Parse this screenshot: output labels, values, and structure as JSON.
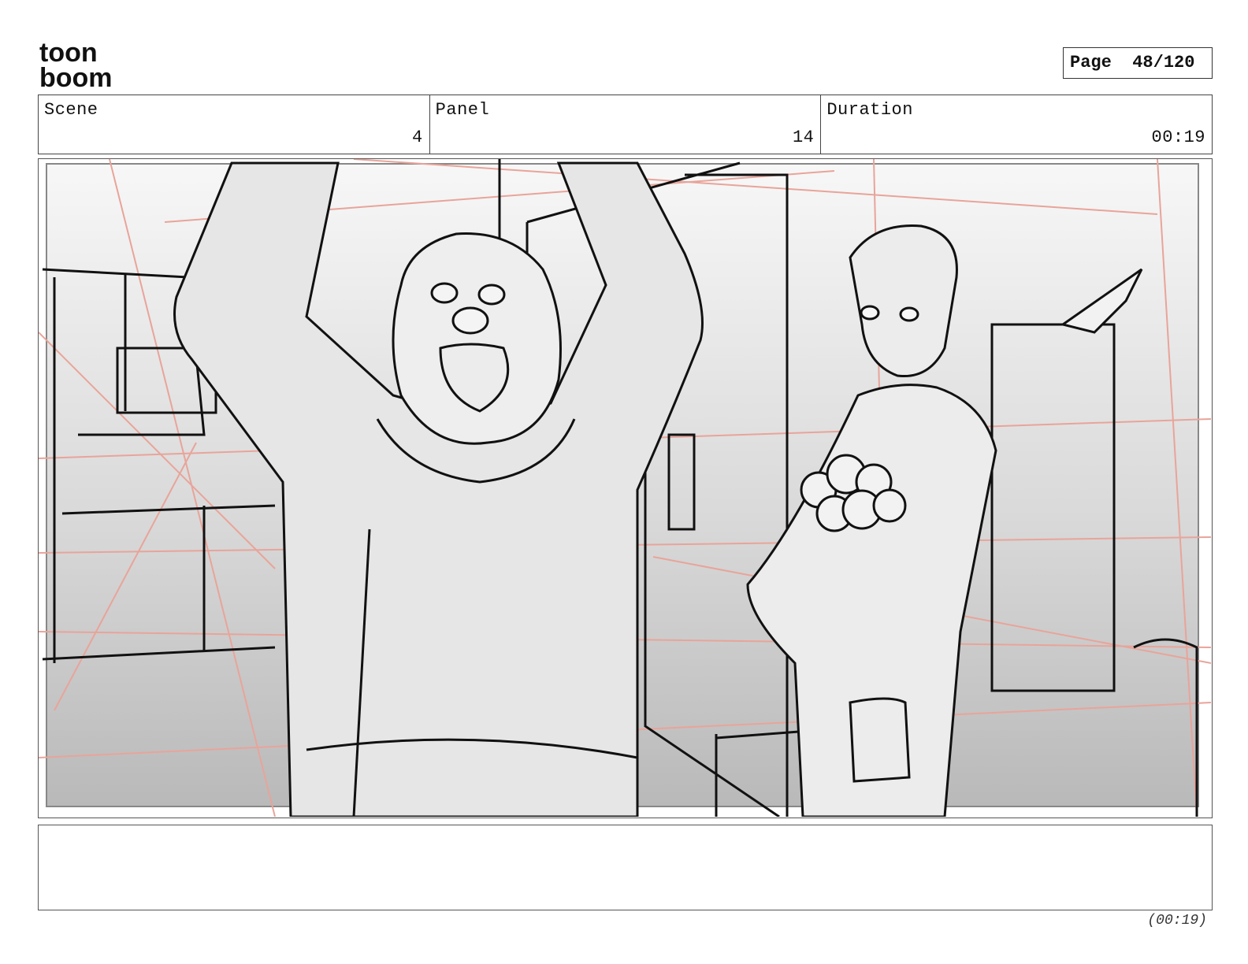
{
  "logo": {
    "line1": "toon",
    "line2": "boom"
  },
  "page": {
    "label": "Page",
    "value": "48/120"
  },
  "header": {
    "scene_label": "Scene",
    "scene_value": "4",
    "panel_label": "Panel",
    "panel_value": "14",
    "duration_label": "Duration",
    "duration_value": "00:19"
  },
  "footer": {
    "duration": "(00:19)"
  },
  "colors": {
    "guide_lines": "#e8a49a",
    "ink": "#111111",
    "panel_bg_top": "#f6f6f6",
    "panel_bg_bottom": "#bdbdbd"
  },
  "icons": [
    "toonboom-logo"
  ]
}
